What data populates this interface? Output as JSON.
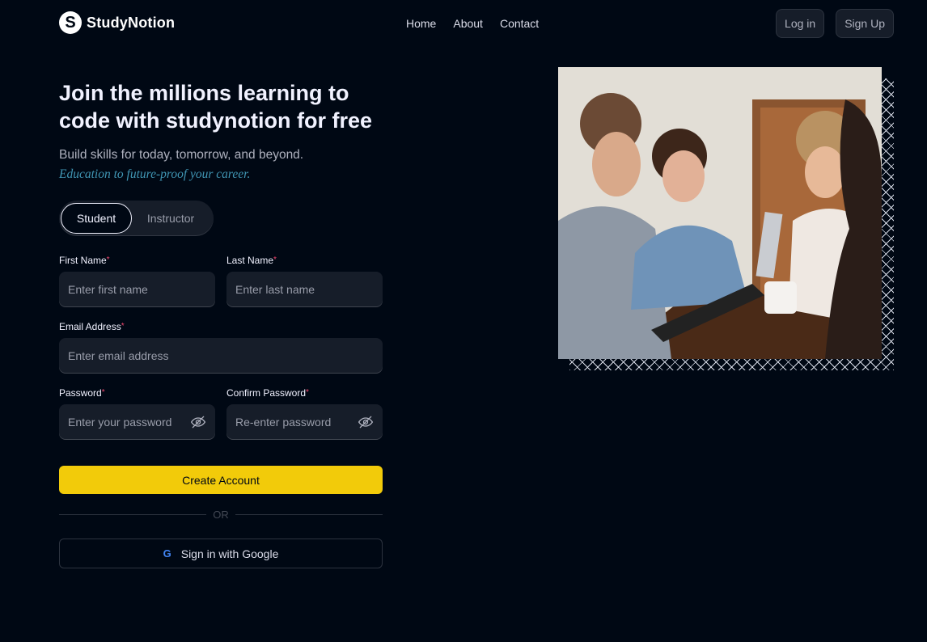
{
  "brand": {
    "logo_letter": "S",
    "name": "StudyNotion"
  },
  "nav": {
    "links": [
      "Home",
      "About",
      "Contact"
    ]
  },
  "auth": {
    "login": "Log in",
    "signup": "Sign Up"
  },
  "hero": {
    "title": "Join the millions learning to code with studynotion for free",
    "subtitle": "Build skills for today, tomorrow, and beyond.",
    "tagline": "Education to future-proof your career."
  },
  "account_type": {
    "options": [
      "Student",
      "Instructor"
    ],
    "selected": "Student"
  },
  "form": {
    "first_name": {
      "label": "First Name",
      "placeholder": "Enter first name"
    },
    "last_name": {
      "label": "Last Name",
      "placeholder": "Enter last name"
    },
    "email": {
      "label": "Email Address",
      "placeholder": "Enter email address"
    },
    "password": {
      "label": "Password",
      "placeholder": "Enter your password"
    },
    "confirm_password": {
      "label": "Confirm Password",
      "placeholder": "Re-enter password"
    },
    "required_mark": "*",
    "submit": "Create Account",
    "divider": "OR",
    "google": "Sign in with Google",
    "google_icon_letter": "G"
  },
  "colors": {
    "background": "#000814",
    "accent": "#FFD60A",
    "tagline": "#47A5C5",
    "required": "#EF476F"
  },
  "icons": [
    "eye-off-icon",
    "google-icon"
  ]
}
